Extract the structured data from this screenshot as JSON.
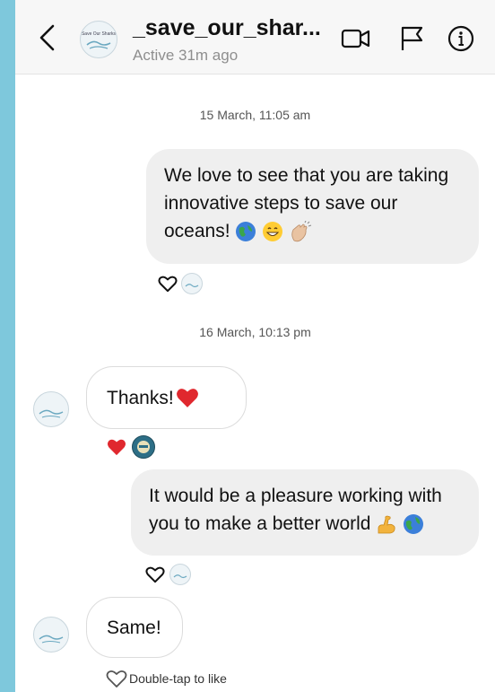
{
  "header": {
    "title": "_save_our_shar...",
    "status": "Active 31m ago",
    "avatar_text": "Save Our Sharks"
  },
  "icons": {
    "back": "chevron-left-icon",
    "video": "video-call-icon",
    "report": "flag-icon",
    "info": "info-icon"
  },
  "thread": {
    "timestamp_1": "15 March, 11:05 am",
    "message_1": "We love to see that you are taking innovative steps to save our oceans!",
    "message_1_line_1": "We love to see that you are taking",
    "message_1_line_2": "innovative steps to save our",
    "message_1_line_3": "oceans!",
    "timestamp_2": "16 March, 10:13 pm",
    "message_2": "Thanks!",
    "message_3": "It would be a pleasure working with you to make a better world",
    "message_3_line_1": "It would be a pleasure working with",
    "message_3_line_2": "you to make a better world",
    "message_4": "Same!",
    "like_hint": "Double-tap to like"
  },
  "colors": {
    "page_background": "#7ec8dc",
    "sent_bubble": "#efefef",
    "heart_red": "#e0282e"
  }
}
